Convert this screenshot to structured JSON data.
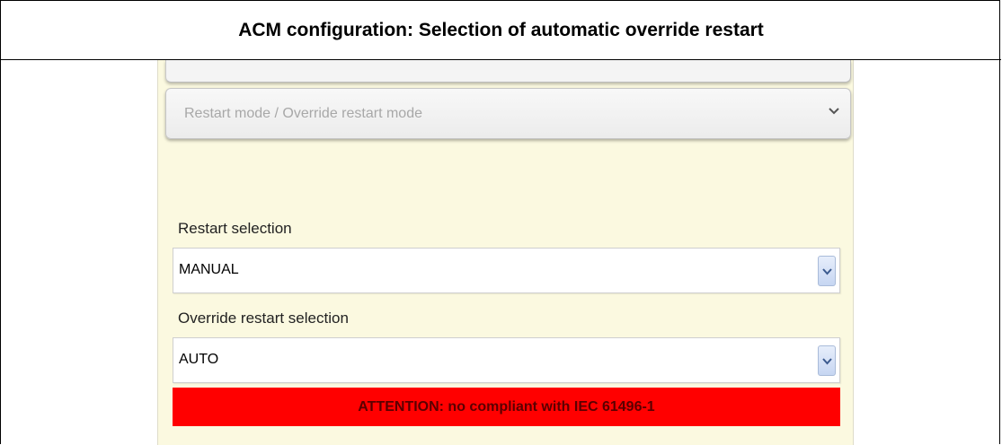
{
  "title": "ACM configuration: Selection of automatic override restart",
  "accordion": {
    "label": "Restart mode / Override restart mode",
    "icon": "chevron-down-icon"
  },
  "restart": {
    "label": "Restart selection",
    "value": "MANUAL"
  },
  "override_restart": {
    "label": "Override restart selection",
    "value": "AUTO"
  },
  "warning": {
    "text": "ATTENTION: no compliant with IEC 61496-1",
    "color": "#ff0000"
  },
  "colors": {
    "panel_background": "#fbf9e0",
    "select_button": "#c6d6f2"
  }
}
